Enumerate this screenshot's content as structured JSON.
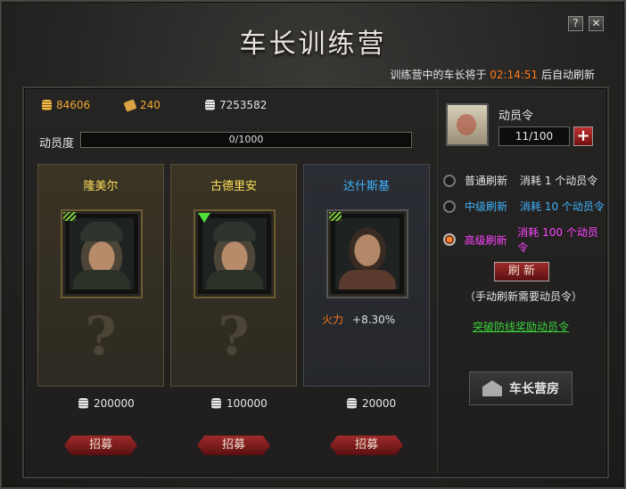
{
  "window": {
    "title": "车长训练营",
    "help_label": "?",
    "close_label": "✕"
  },
  "refresh_info": {
    "prefix": "训练营中的车长将于 ",
    "time": "02:14:51",
    "suffix": " 后自动刷新"
  },
  "resources": {
    "gold": "84606",
    "tickets": "240",
    "silver": "7253582"
  },
  "mobilization": {
    "label": "动员度",
    "value": "0/1000",
    "progress": 0
  },
  "commanders": [
    {
      "name": "隆美尔",
      "cost": "200000",
      "recruit_label": "招募",
      "style": "gold"
    },
    {
      "name": "古德里安",
      "cost": "100000",
      "recruit_label": "招募",
      "style": "gold"
    },
    {
      "name": "达什斯基",
      "cost": "20000",
      "recruit_label": "招募",
      "style": "blue",
      "stat_label": "火力",
      "stat_value": "+8.30%"
    }
  ],
  "mystery_mark": "?",
  "order": {
    "label": "动员令",
    "count": "11/100",
    "plus_label": "+"
  },
  "refresh_options": [
    {
      "name": "普通刷新",
      "cost": "消耗 1 个动员令",
      "selected": false,
      "color": "#e6e6e6"
    },
    {
      "name": "中级刷新",
      "cost": "消耗 10 个动员令",
      "selected": false,
      "color": "#3fb4ff"
    },
    {
      "name": "高级刷新",
      "cost": "消耗 100 个动员令",
      "selected": true,
      "color": "#ff44ff"
    }
  ],
  "refresh_button": "刷 新",
  "refresh_note": "（手动刷新需要动员令）",
  "breakthrough_link": "突破防线奖励动员令",
  "barracks_button": "车长营房"
}
